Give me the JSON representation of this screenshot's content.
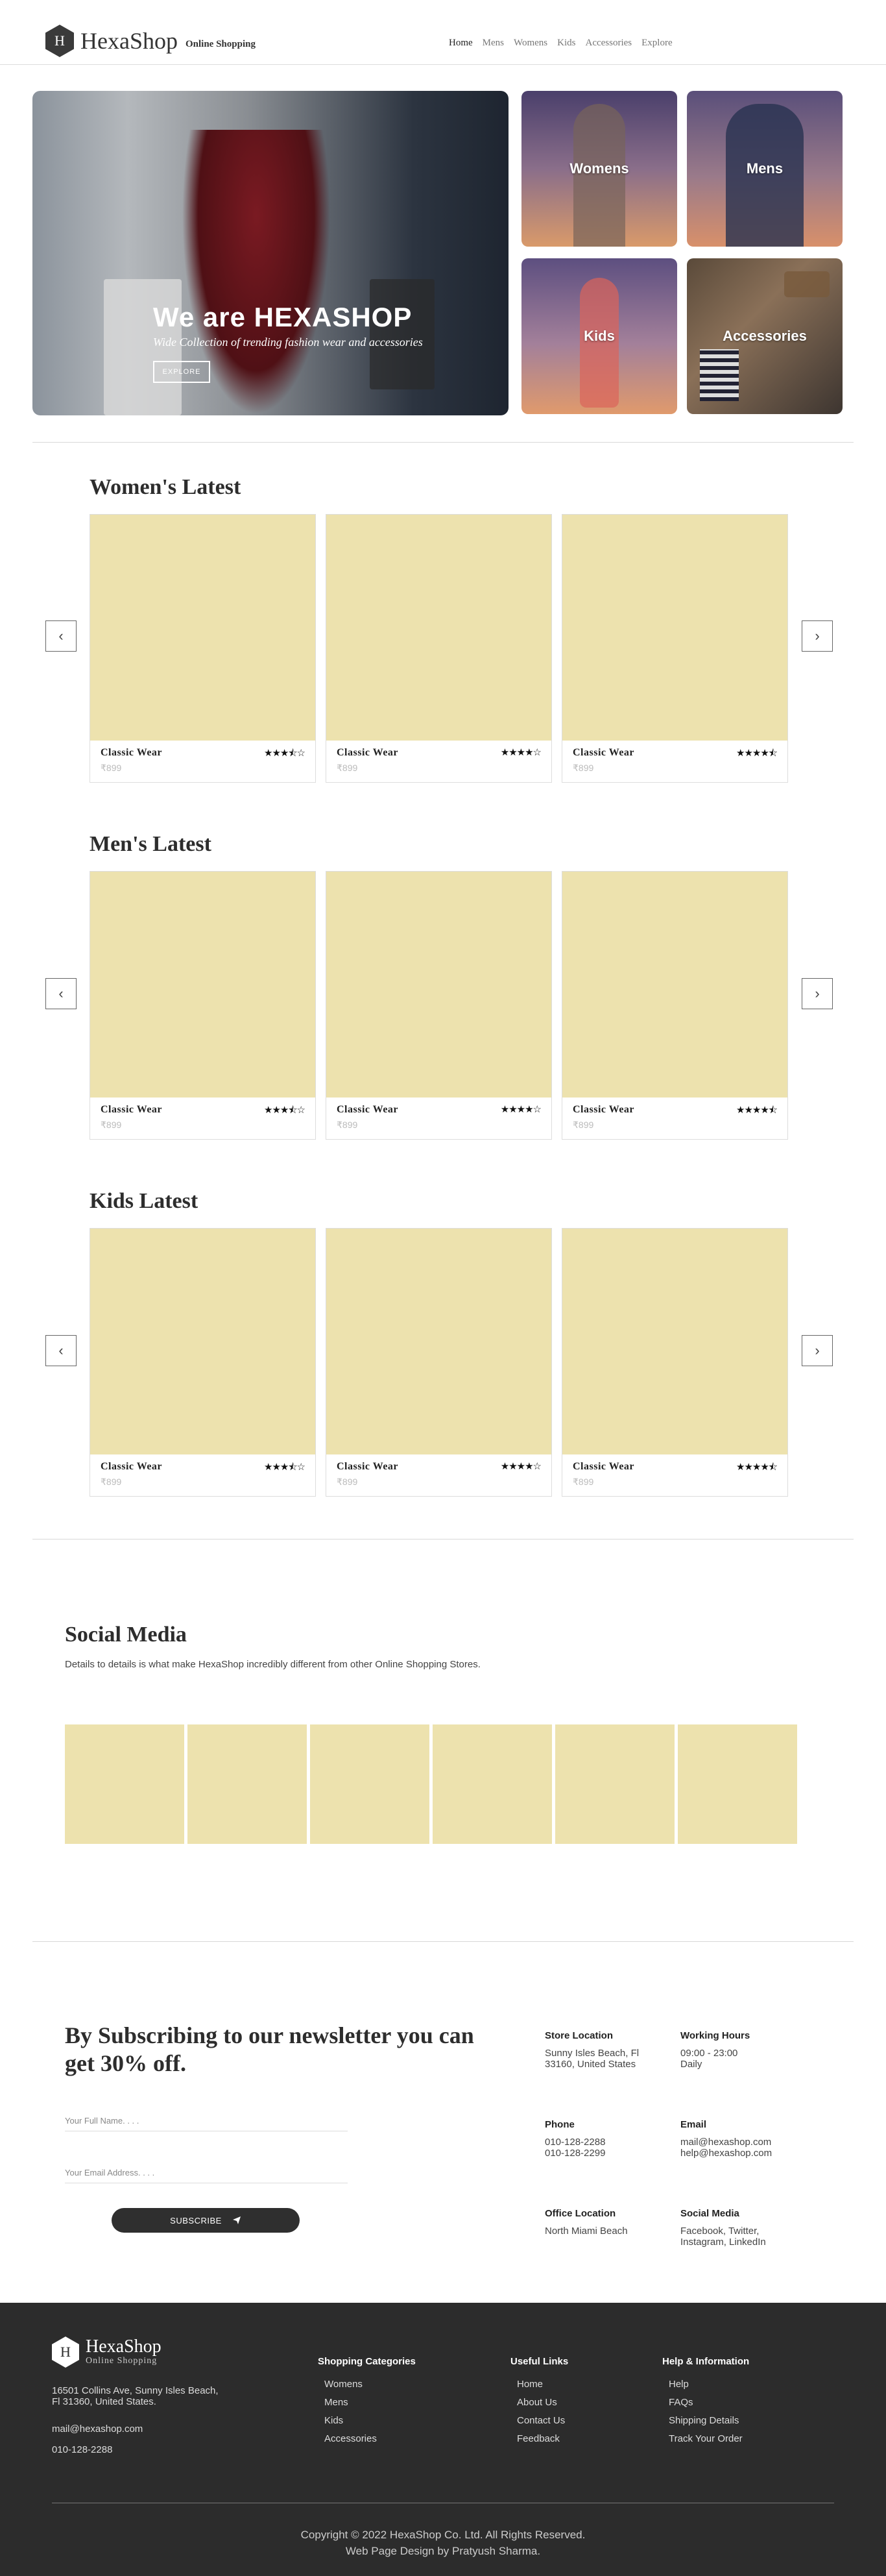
{
  "header": {
    "logo_letter": "H",
    "brand": "HexaShop",
    "tagline": "Online Shopping",
    "nav": [
      "Home",
      "Mens",
      "Womens",
      "Kids",
      "Accessories",
      "Explore"
    ]
  },
  "hero": {
    "title": "We are HEXASHOP",
    "subtitle": "Wide Collection of trending fashion wear and accessories",
    "button": "EXPLORE"
  },
  "categories": [
    "Womens",
    "Mens",
    "Kids",
    "Accessories"
  ],
  "sections": [
    {
      "title": "Women's Latest",
      "products": [
        {
          "name": "Classic Wear",
          "price": "₹899",
          "rating": 3.5,
          "stars": "★★★⯪☆"
        },
        {
          "name": "Classic Wear",
          "price": "₹899",
          "rating": 4,
          "stars": "★★★★☆"
        },
        {
          "name": "Classic Wear",
          "price": "₹899",
          "rating": 4.5,
          "stars": "★★★★⯪"
        }
      ]
    },
    {
      "title": "Men's Latest",
      "products": [
        {
          "name": "Classic Wear",
          "price": "₹899",
          "rating": 3.5,
          "stars": "★★★⯪☆"
        },
        {
          "name": "Classic Wear",
          "price": "₹899",
          "rating": 4,
          "stars": "★★★★☆"
        },
        {
          "name": "Classic Wear",
          "price": "₹899",
          "rating": 4.5,
          "stars": "★★★★⯪"
        }
      ]
    },
    {
      "title": "Kids Latest",
      "products": [
        {
          "name": "Classic Wear",
          "price": "₹899",
          "rating": 3.5,
          "stars": "★★★⯪☆"
        },
        {
          "name": "Classic Wear",
          "price": "₹899",
          "rating": 4,
          "stars": "★★★★☆"
        },
        {
          "name": "Classic Wear",
          "price": "₹899",
          "rating": 4.5,
          "stars": "★★★★⯪"
        }
      ]
    }
  ],
  "arrows": {
    "prev": "‹",
    "next": "›"
  },
  "social": {
    "title": "Social Media",
    "description": "Details to details is what make HexaShop incredibly different from other Online Shopping Stores."
  },
  "newsletter": {
    "title": "By Subscribing to our newsletter you can get 30% off.",
    "name_placeholder": "Your Full Name. . . .",
    "email_placeholder": "Your Email Address. . . .",
    "button": "SUBSCRIBE",
    "info": [
      {
        "heading": "Store Location",
        "lines": [
          "Sunny Isles Beach, Fl",
          "33160, United States"
        ]
      },
      {
        "heading": "Working Hours",
        "lines": [
          "09:00 - 23:00",
          "Daily"
        ]
      },
      {
        "heading": "Phone",
        "lines": [
          "010-128-2288",
          "010-128-2299"
        ]
      },
      {
        "heading": "Email",
        "lines": [
          "mail@hexashop.com",
          "help@hexashop.com"
        ]
      },
      {
        "heading": "Office Location",
        "lines": [
          "North Miami Beach"
        ]
      },
      {
        "heading": "Social Media",
        "lines": [
          "Facebook, Twitter,",
          "Instagram, LinkedIn"
        ]
      }
    ]
  },
  "footer": {
    "brand": "HexaShop",
    "tagline": "Online Shopping",
    "address": [
      "16501 Collins Ave, Sunny Isles Beach,",
      "Fl 31360, United States."
    ],
    "email": "mail@hexashop.com",
    "phone": "010-128-2288",
    "columns": [
      {
        "title": "Shopping Categories",
        "items": [
          "Womens",
          "Mens",
          "Kids",
          "Accessories"
        ]
      },
      {
        "title": "Useful Links",
        "items": [
          "Home",
          "About Us",
          "Contact Us",
          "Feedback"
        ]
      },
      {
        "title": "Help & Information",
        "items": [
          "Help",
          "FAQs",
          "Shipping Details",
          "Track Your Order"
        ]
      }
    ],
    "copyright": "Copyright © 2022 HexaShop Co. Ltd. All Rights Reserved.",
    "credit": "Web Page Design by Pratyush Sharma."
  }
}
